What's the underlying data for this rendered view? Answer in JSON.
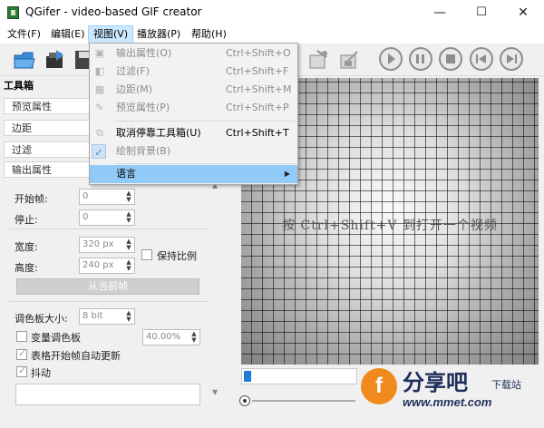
{
  "window": {
    "title": "QGifer - video-based GIF creator",
    "minimize": "—",
    "maximize": "☐",
    "close": "✕"
  },
  "menubar": {
    "items": [
      {
        "label": "文件(F)"
      },
      {
        "label": "编辑(E)"
      },
      {
        "label": "视图(V)"
      },
      {
        "label": "播放器(P)"
      },
      {
        "label": "帮助(H)"
      }
    ]
  },
  "view_menu": {
    "items": [
      {
        "label": "输出属性(O)",
        "shortcut": "Ctrl+Shift+O",
        "icon": "output-icon"
      },
      {
        "label": "过滤(F)",
        "shortcut": "Ctrl+Shift+F",
        "icon": "filter-icon"
      },
      {
        "label": "边距(M)",
        "shortcut": "Ctrl+Shift+M",
        "icon": "margins-icon"
      },
      {
        "label": "预览属性(P)",
        "shortcut": "Ctrl+Shift+P",
        "icon": "preview-icon"
      },
      {
        "label": "取消停靠工具箱(U)",
        "shortcut": "Ctrl+Shift+T",
        "icon": "undock-icon"
      },
      {
        "label": "绘制背景(B)",
        "checked": true
      },
      {
        "label": "语言"
      }
    ]
  },
  "toolbox": {
    "title": "工具箱",
    "sections": [
      {
        "label": "预览属性"
      },
      {
        "label": "边距"
      },
      {
        "label": "过滤"
      },
      {
        "label": "输出属性"
      }
    ],
    "start_frame": {
      "label": "开始帧:",
      "value": "0"
    },
    "stop": {
      "label": "停止:",
      "value": "0"
    },
    "width": {
      "label": "宽度:",
      "value": "320 px"
    },
    "height": {
      "label": "高度:",
      "value": "240 px"
    },
    "keep_ratio": {
      "label": "保持比例",
      "checked": false
    },
    "from_current_button": "从当前帧",
    "palette": {
      "label": "调色板大小:",
      "value": "8 bit"
    },
    "variable_palette": {
      "label": "变量调色板",
      "checked": false,
      "value": "40.00%"
    },
    "auto_update": {
      "label": "表格开始帧自动更新",
      "checked": true
    },
    "dither": {
      "label": "抖动",
      "checked": true
    }
  },
  "preview": {
    "hint": "按 Ctrl+Shift+V 到打开一个视频"
  },
  "watermark": {
    "mark": "f",
    "brand": "分享吧",
    "sub": "下载站",
    "url": "www.mmet.com"
  },
  "colors": {
    "accent": "#1e7ad6",
    "menu_highlight": "#91c9f7",
    "watermark_orange": "#f08a1c",
    "watermark_navy": "#1e2e5a"
  }
}
